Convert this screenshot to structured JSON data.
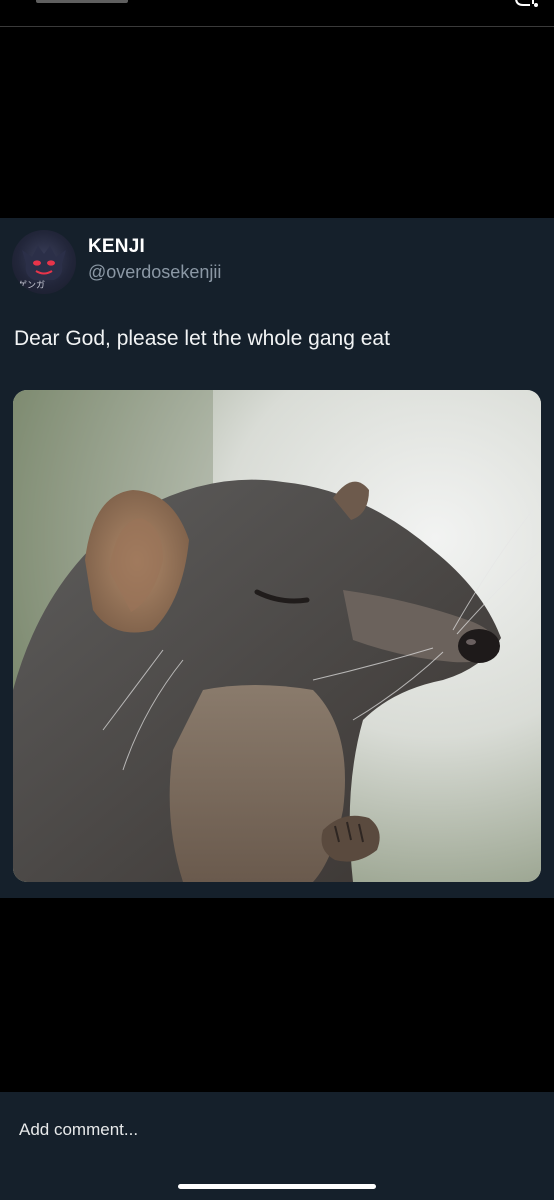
{
  "tweet": {
    "display_name": "KENJI",
    "handle": "@overdosekenjii",
    "text": "Dear God, please let the whole gang eat",
    "avatar_text": "ゲンガ",
    "media_description_icon": "photo-rodent-icon"
  },
  "comment": {
    "placeholder": "Add comment..."
  },
  "icons": {
    "top_right": "share-arrow-icon"
  },
  "colors": {
    "card_background": "#15202b",
    "page_background": "#000000",
    "handle_text": "#8b98a5"
  }
}
